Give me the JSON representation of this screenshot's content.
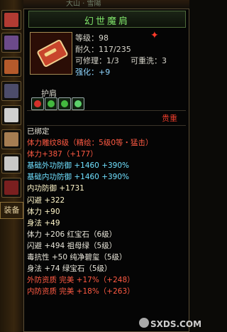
{
  "sidebar": {
    "equip_label": "装备",
    "slots": [
      {
        "name": "helmet",
        "color": "#b23b33"
      },
      {
        "name": "scroll",
        "color": "#6c4a8a"
      },
      {
        "name": "shoulder",
        "color": "#b55a2b"
      },
      {
        "name": "boots",
        "color": "#4c4c6a"
      },
      {
        "name": "jade",
        "color": "#cfcfcf"
      },
      {
        "name": "ring",
        "color": "#a57d52"
      },
      {
        "name": "bracelet",
        "color": "#c8c8c8"
      },
      {
        "name": "charm",
        "color": "#7a1f1f"
      }
    ]
  },
  "top_strip_text": "大山 · 雪陽",
  "item": {
    "title": "幻世魔肩",
    "level": "等级：98",
    "durability": "耐久：117/235",
    "repairable": "可修理：1/3",
    "rewash": "可重洗：3",
    "strengthen": "强化：+9",
    "slot_type": "护肩",
    "rarity": "贵重",
    "gem_colors": [
      "#d2302a",
      "#43b83f",
      "#43b83f",
      "#5cd06b"
    ]
  },
  "attributes": [
    {
      "text": "已绑定",
      "style": "white"
    },
    {
      "text": "体力雕纹8级（精绘：5级0等・猛击）",
      "style": "red"
    },
    {
      "text": "体力+387（+177）",
      "style": "red"
    },
    {
      "text": "基础外功防御 +1460 +390%",
      "style": "teal"
    },
    {
      "text": "基础内功防御 +1460 +390%",
      "style": "teal"
    },
    {
      "text": "内功防御 +1731",
      "style": "yellow"
    },
    {
      "text": "闪避 +322",
      "style": "yellow"
    },
    {
      "text": "体力 +90",
      "style": "yellow"
    },
    {
      "text": "身法 +49",
      "style": "yellow"
    },
    {
      "text": "体力 +206 红宝石（6级）",
      "style": "white"
    },
    {
      "text": "闪避 +494 祖母绿（5级）",
      "style": "white"
    },
    {
      "text": "毒抗性 +50 纯净碧玺（5级）",
      "style": "white"
    },
    {
      "text": "身法 +74 绿宝石（5级）",
      "style": "white"
    },
    {
      "text": "外防资质 完美 +17%（+248）",
      "style": "red"
    },
    {
      "text": "内防资质 完美 +18%（+263）",
      "style": "red"
    }
  ],
  "watermark": "SXDS.COM"
}
